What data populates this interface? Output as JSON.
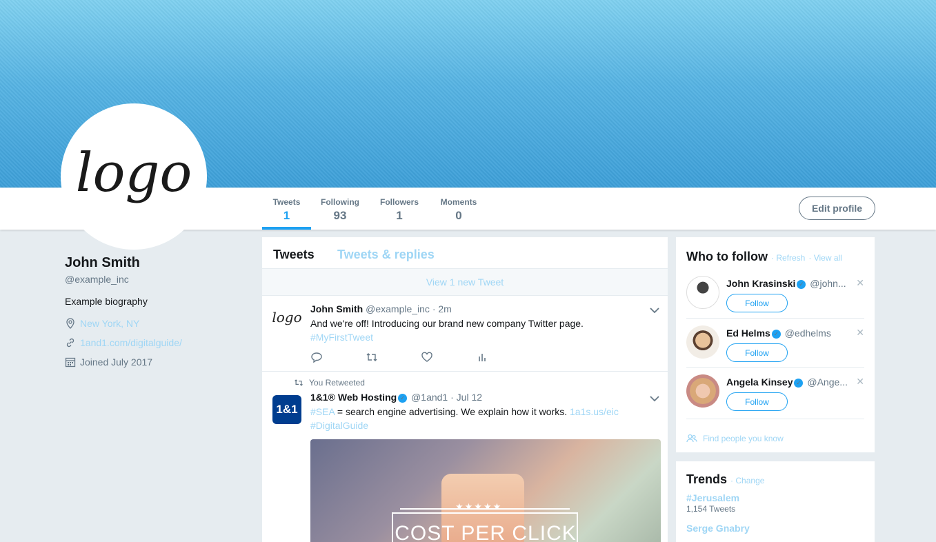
{
  "profile": {
    "avatar_text": "logo",
    "name": "John Smith",
    "handle": "@example_inc",
    "bio": "Example biography",
    "location": "New York, NY",
    "website": "1and1.com/digitalguide/",
    "joined": "Joined July 2017"
  },
  "nav": {
    "stats": [
      {
        "label": "Tweets",
        "value": "1"
      },
      {
        "label": "Following",
        "value": "93"
      },
      {
        "label": "Followers",
        "value": "1"
      },
      {
        "label": "Moments",
        "value": "0"
      }
    ],
    "edit_profile": "Edit profile"
  },
  "timeline": {
    "tabs": [
      "Tweets",
      "Tweets & replies"
    ],
    "new_tweets": "View 1 new Tweet",
    "tweets": [
      {
        "avatar_text": "logo",
        "name": "John Smith",
        "handle": "@example_inc",
        "time": "· 2m",
        "text": "And we're off! Introducing our brand new company Twitter page.",
        "hashtag": "#MyFirstTweet"
      },
      {
        "retweet_label": "You Retweeted",
        "avatar_text": "1&1",
        "name": "1&1® Web Hosting",
        "handle": "@1and1",
        "time": "· Jul 12",
        "hashtag1": "#SEA",
        "text": " = search engine advertising. We explain how it works. ",
        "link": "1a1s.us/eic",
        "hashtag2": "#DigitalGuide",
        "media_caption": "COST PER CLICK",
        "media_stars": "★★★★★"
      }
    ]
  },
  "who_to_follow": {
    "title": "Who to follow",
    "refresh": "· Refresh",
    "view_all": "· View all",
    "follow_label": "Follow",
    "users": [
      {
        "name": "John Krasinski",
        "handle": "@john..."
      },
      {
        "name": "Ed Helms",
        "handle": "@edhelms"
      },
      {
        "name": "Angela Kinsey",
        "handle": "@Ange..."
      }
    ],
    "find_people": "Find people you know"
  },
  "trends": {
    "title": "Trends",
    "change": "· Change",
    "items": [
      {
        "name": "#Jerusalem",
        "count": "1,154 Tweets"
      },
      {
        "name": "Serge Gnabry",
        "count": ""
      }
    ]
  },
  "colors": {
    "accent": "#1da1f2",
    "link_light": "#9fd6f5",
    "brand_1and1": "#003d8f"
  }
}
